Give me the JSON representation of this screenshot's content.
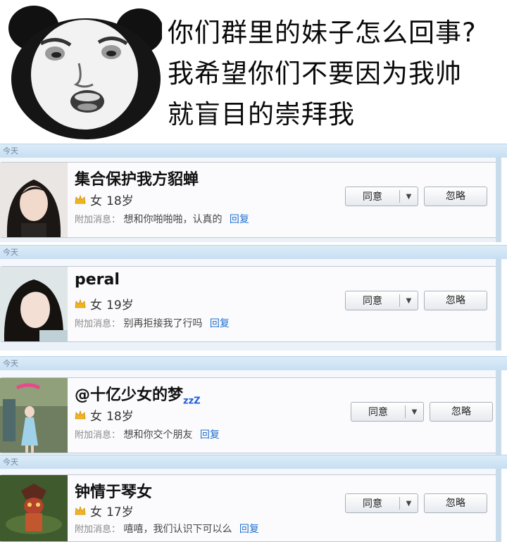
{
  "caption": {
    "line1": "你们群里的妹子怎么回事?",
    "line2": "我希望你们不要因为我帅",
    "line3": "就盲目的崇拜我"
  },
  "requests": [
    {
      "day": "今天",
      "nickname": "集合保护我方貂蝉",
      "gender": "女",
      "age": "18岁",
      "message_prefix": "附加消息：",
      "message": "想和你啪啪啪，认真的",
      "reply": "回复",
      "agree": "同意",
      "ignore": "忽略"
    },
    {
      "day": "今天",
      "nickname": "peral",
      "gender": "女",
      "age": "19岁",
      "message_prefix": "附加消息：",
      "message": "别再拒接我了行吗",
      "reply": "回复",
      "agree": "同意",
      "ignore": "忽略"
    },
    {
      "day": "今天",
      "nickname": "@十亿少女的梦",
      "nickname_suffix": "zzZ",
      "gender": "女",
      "age": "18岁",
      "message_prefix": "附加消息：",
      "message": "想和你交个朋友",
      "reply": "回复",
      "agree": "同意",
      "ignore": "忽略"
    },
    {
      "day": "今天",
      "nickname": "钟情于琴女",
      "gender": "女",
      "age": "17岁",
      "message_prefix": "附加消息：",
      "message": "嘻嘻，我们认识下可以么",
      "reply": "回复",
      "agree": "同意",
      "ignore": "忽略"
    }
  ],
  "colors": {
    "day_bar": "#c7dff2",
    "reply_link": "#1f6fd0",
    "crown": "#f2b51b"
  },
  "icons": {
    "crown": "crown-icon",
    "dropdown": "chevron-down-icon"
  }
}
